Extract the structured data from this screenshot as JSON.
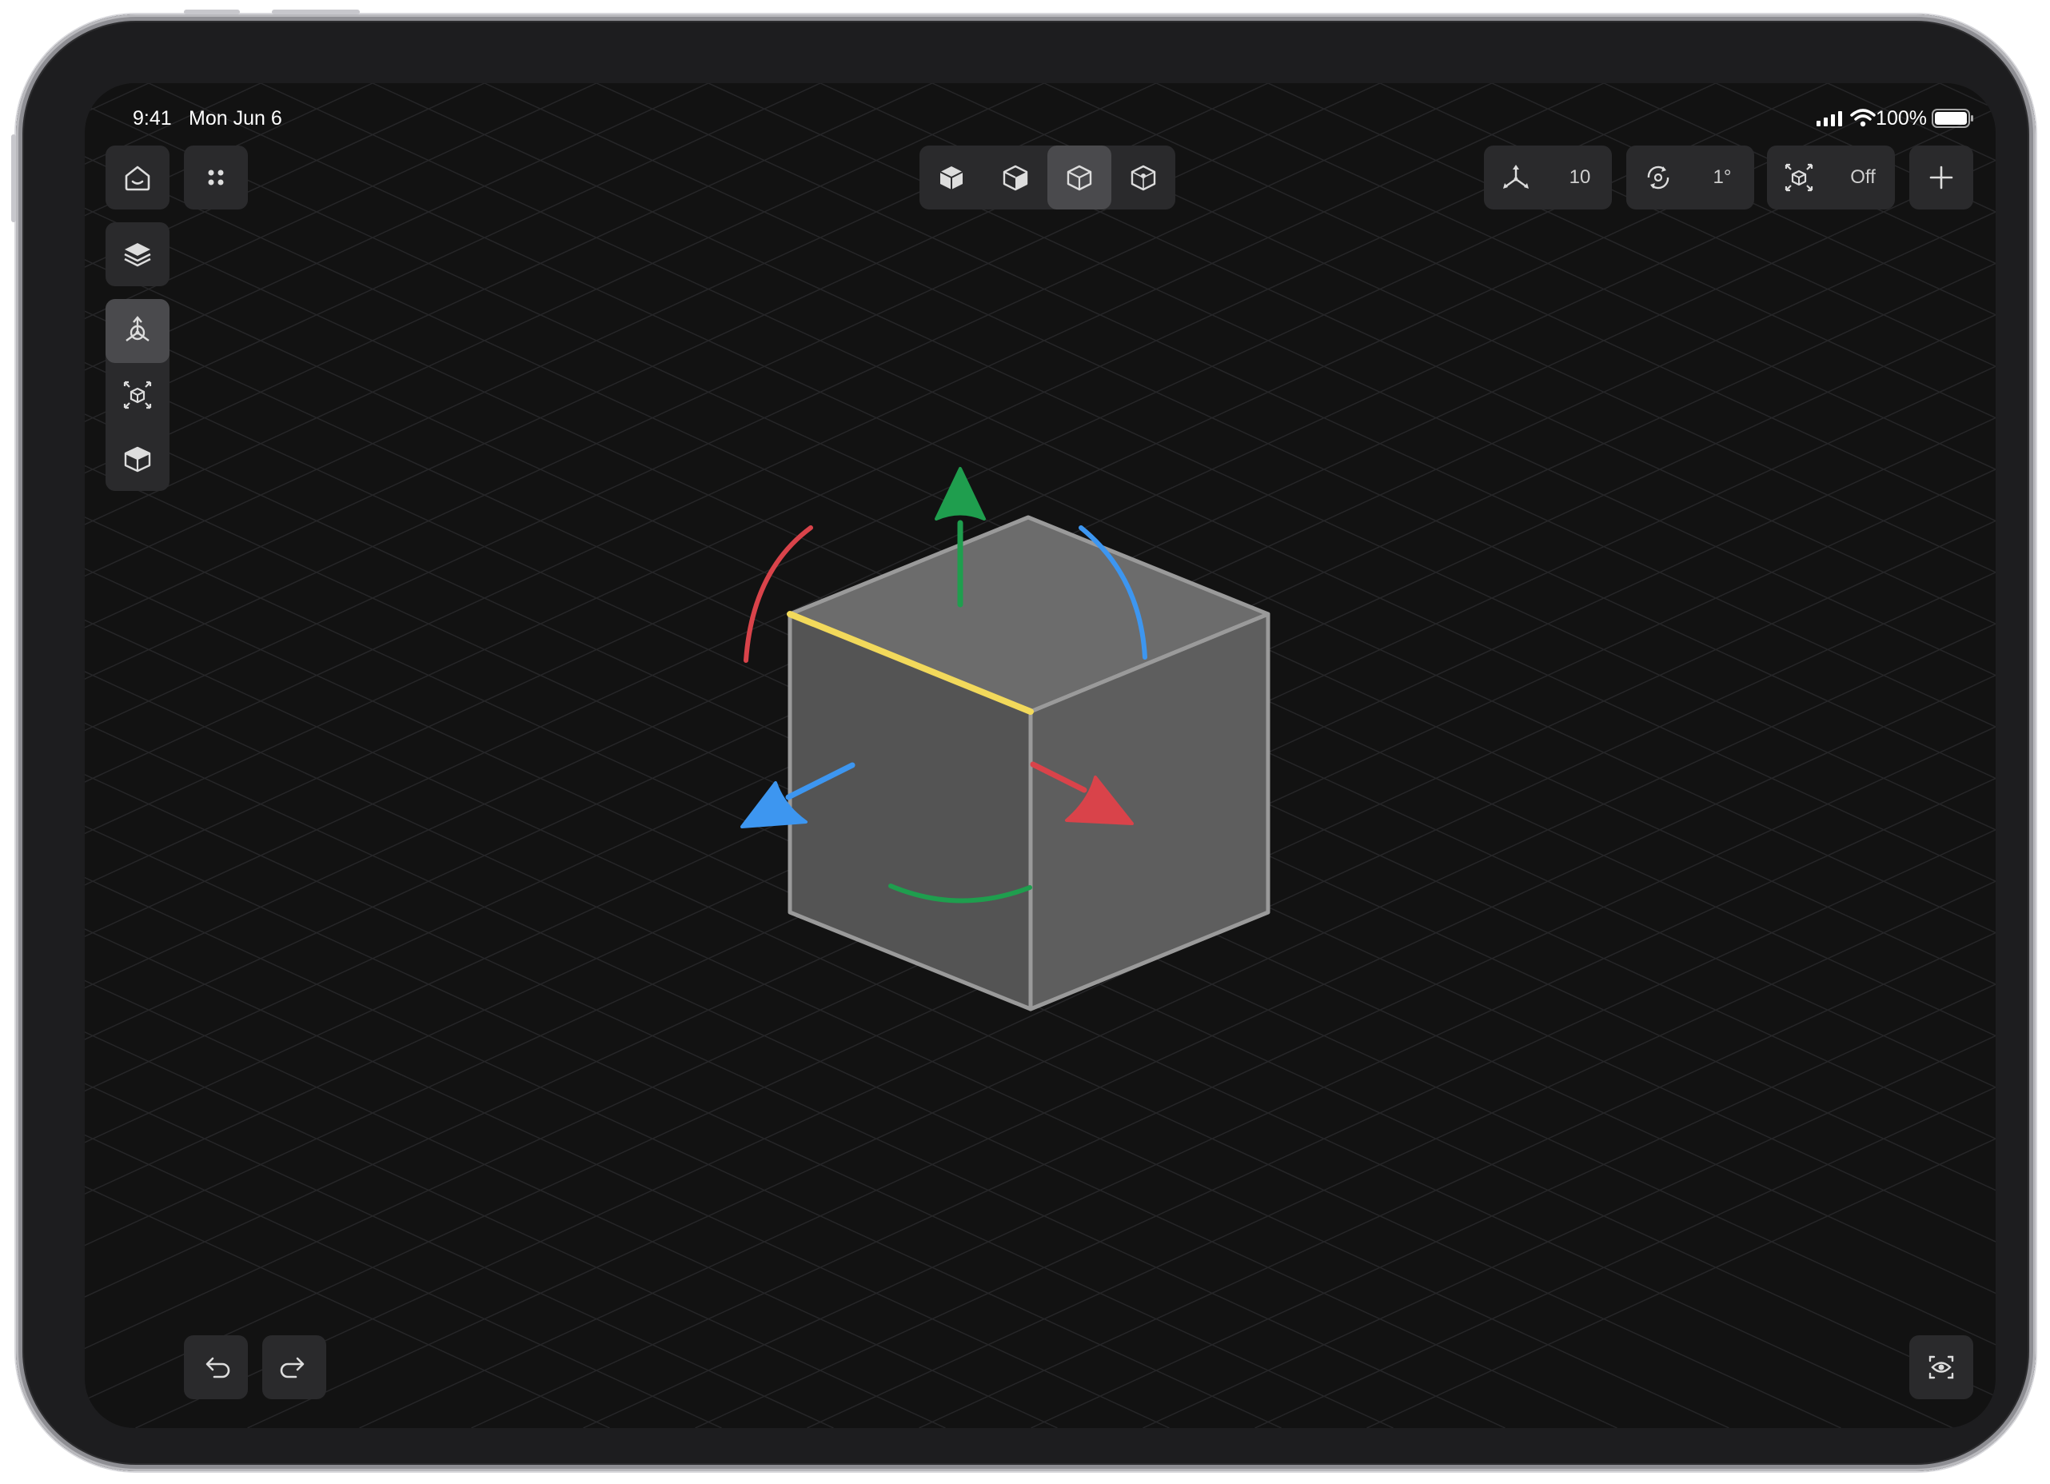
{
  "status_bar": {
    "time": "9:41",
    "date": "Mon Jun 6",
    "battery": "100%",
    "icons": [
      "signal-icon",
      "wifi-icon",
      "battery-icon"
    ]
  },
  "top_left": {
    "icons": [
      "home-icon",
      "grid-dots-icon"
    ]
  },
  "sidebar": {
    "items": [
      {
        "icon": "layers-icon",
        "active": false
      },
      {
        "icon": "transform-gizmo-icon",
        "active": true
      },
      {
        "icon": "scale-icon",
        "active": false
      },
      {
        "icon": "extrude-icon",
        "active": false
      }
    ]
  },
  "view_modes": {
    "items": [
      "solid-view-icon",
      "shaded-view-icon",
      "wireframe-view-icon",
      "vertex-view-icon"
    ],
    "selected_index": 2
  },
  "snapping": {
    "move": {
      "icon": "move-snap-icon",
      "value": "10"
    },
    "rotate": {
      "icon": "rotate-snap-icon",
      "value": "1°"
    },
    "scale": {
      "icon": "scale-snap-icon",
      "value": "Off"
    },
    "add": {
      "icon": "plus-icon"
    }
  },
  "bottom": {
    "icons": [
      "undo-icon",
      "redo-icon",
      "view-eye-icon"
    ]
  },
  "colors": {
    "background": "#121212",
    "panel": "#2a2a2c",
    "cube_face": "#5c5c5c",
    "cube_edge": "#9a9a9a",
    "axis_x": "#d9434a",
    "axis_y": "#1f9e4e",
    "axis_z": "#3d96f0",
    "highlight_edge": "#f2d95b"
  }
}
